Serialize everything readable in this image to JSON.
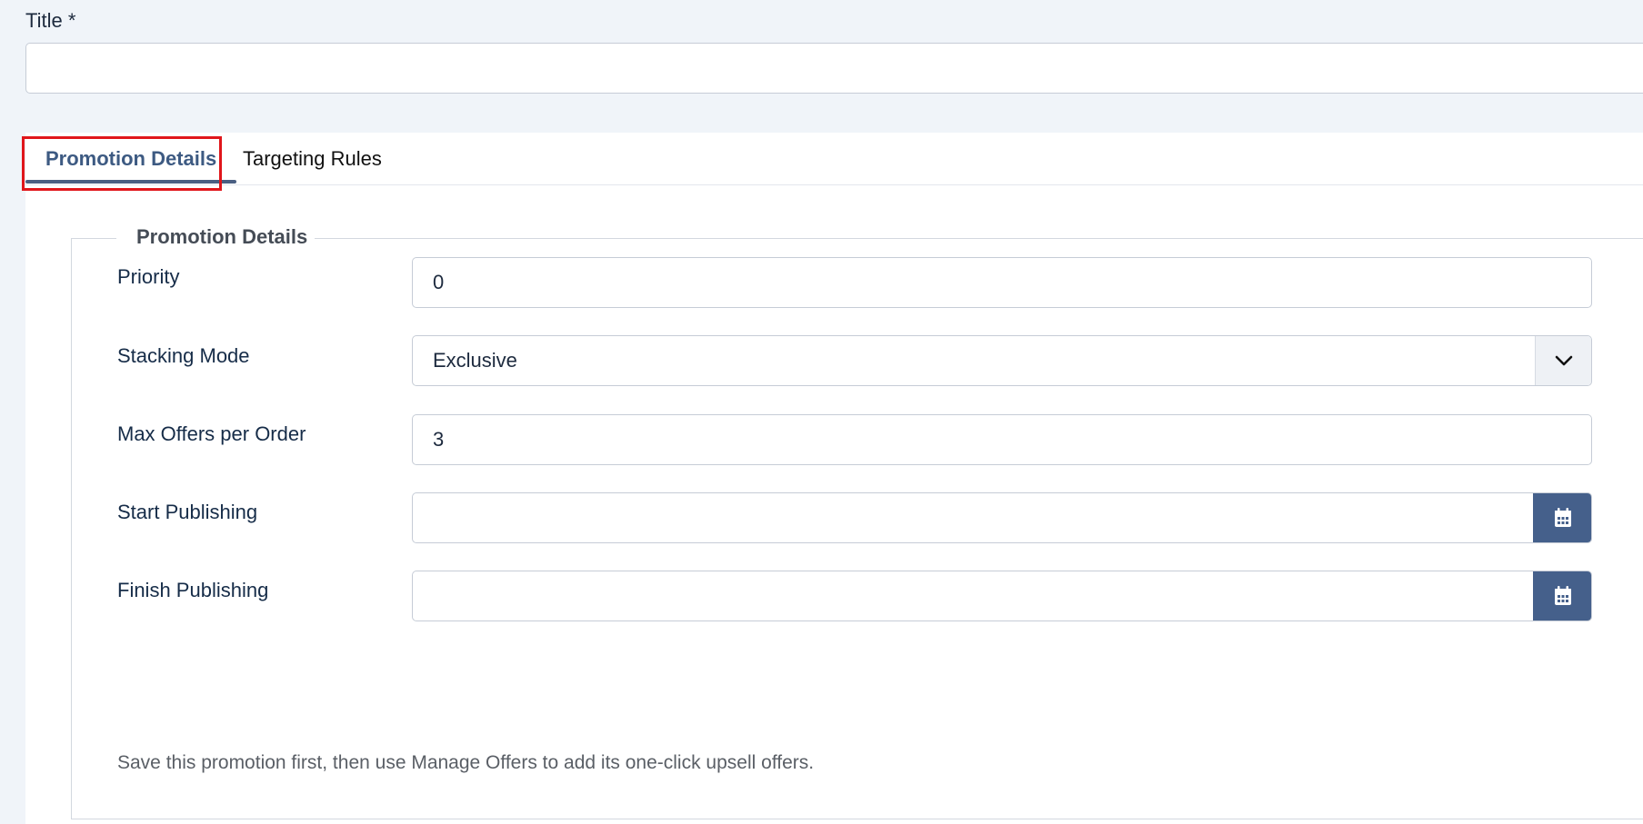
{
  "title_field": {
    "label": "Title *",
    "value": "",
    "placeholder": ""
  },
  "tabs": [
    {
      "label": "Promotion Details",
      "active": true
    },
    {
      "label": "Targeting Rules",
      "active": false
    }
  ],
  "fieldset": {
    "legend": "Promotion Details",
    "fields": {
      "priority": {
        "label": "Priority",
        "value": "0"
      },
      "stacking_mode": {
        "label": "Stacking Mode",
        "value": "Exclusive"
      },
      "max_offers": {
        "label": "Max Offers per Order",
        "value": "3"
      },
      "start_publishing": {
        "label": "Start Publishing",
        "value": ""
      },
      "finish_publishing": {
        "label": "Finish Publishing",
        "value": ""
      }
    },
    "help_text": "Save this promotion first, then use Manage Offers to add its one-click upsell offers."
  },
  "icons": {
    "select": "chevron-down-icon",
    "date": "calendar-icon"
  },
  "colors": {
    "page_background": "#f0f4f9",
    "active_tab": "#3d5a82",
    "calendar_button": "#45608b",
    "highlight": "#e0161b"
  }
}
